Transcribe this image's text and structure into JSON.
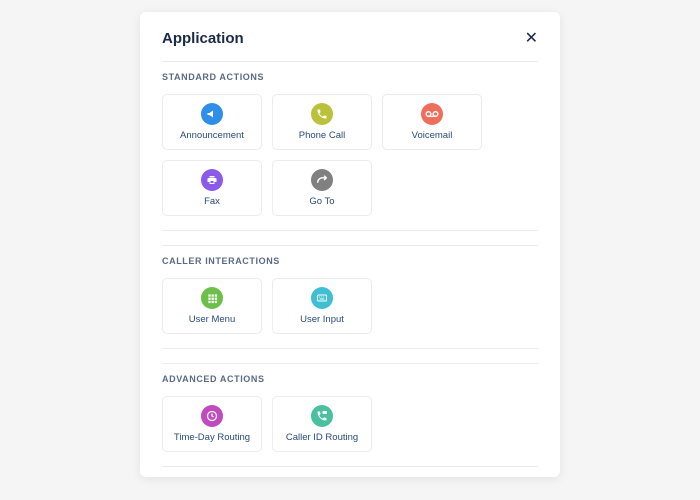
{
  "header": {
    "title": "Application"
  },
  "sections": {
    "standard": {
      "title": "STANDARD ACTIONS",
      "items": {
        "announcement": {
          "label": "Announcement",
          "icon": "announcement-icon",
          "color": "#2f8fe8"
        },
        "phonecall": {
          "label": "Phone Call",
          "icon": "phone-icon",
          "color": "#b9c23a"
        },
        "voicemail": {
          "label": "Voicemail",
          "icon": "voicemail-icon",
          "color": "#ee6e5b"
        },
        "fax": {
          "label": "Fax",
          "icon": "fax-icon",
          "color": "#8a5be9"
        },
        "goto": {
          "label": "Go To",
          "icon": "goto-icon",
          "color": "#808080"
        }
      }
    },
    "caller": {
      "title": "CALLER INTERACTIONS",
      "items": {
        "usermenu": {
          "label": "User Menu",
          "icon": "user-menu-icon",
          "color": "#6cc04a"
        },
        "userinput": {
          "label": "User Input",
          "icon": "user-input-icon",
          "color": "#3fbfd1"
        }
      }
    },
    "advanced": {
      "title": "ADVANCED ACTIONS",
      "items": {
        "timeday": {
          "label": "Time-Day Routing",
          "icon": "clock-icon",
          "color": "#c04ac0"
        },
        "callerid": {
          "label": "Caller ID Routing",
          "icon": "caller-id-icon",
          "color": "#4ac0a0"
        }
      }
    }
  }
}
